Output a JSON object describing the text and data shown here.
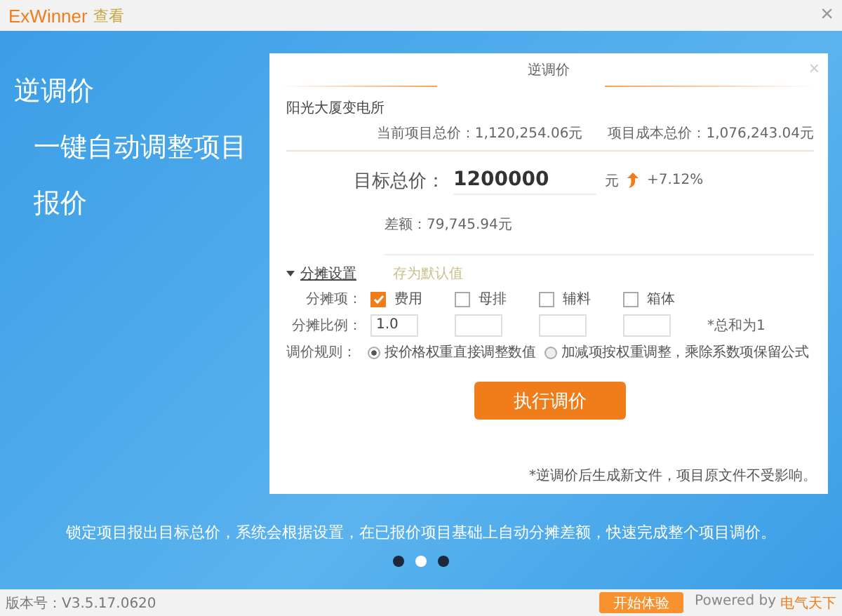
{
  "window": {
    "app_name": "ExWinner",
    "title": "查看",
    "close": "×"
  },
  "slide": {
    "heading": "逆调价",
    "subheading_lines": [
      "一键自动调整项目",
      "报价"
    ],
    "dialog": {
      "title": "逆调价",
      "close": "×",
      "project": "阳光大厦变电所",
      "current_total": "当前项目总价：1,120,254.06元",
      "cost_total": "项目成本总价：1,076,243.04元",
      "target_label": "目标总价：",
      "target_value": "1200000",
      "target_unit": "元",
      "change": "+7.12%",
      "difference": "差额：79,745.94元",
      "settings_toggle": "分摊设置",
      "settings_expanded": true,
      "save_default": "存为默认值",
      "items_label": "分摊项：",
      "items": [
        {
          "label": "费用",
          "checked": true,
          "ratio": "1.0"
        },
        {
          "label": "母排",
          "checked": false
        },
        {
          "label": "辅料",
          "checked": false
        },
        {
          "label": "箱体",
          "checked": false
        }
      ],
      "ratio_label": "分摊比例：",
      "ratio_note": "*总和为1",
      "rule_label": "调价规则：",
      "rules": [
        {
          "label": "按价格权重直接调整数值",
          "selected": true
        },
        {
          "label": "加减项按权重调整，乘除系数项保留公式",
          "selected": false
        }
      ],
      "run_button": "执行调价",
      "footnote": "*逆调价后生成新文件，项目原文件不受影响。"
    },
    "caption": "锁定项目报出目标总价，系统会根据设置，在已报价项目基础上自动分摊差额，快速完成整个项目调价。",
    "dots": [
      {
        "selected": false
      },
      {
        "selected": true
      },
      {
        "selected": false
      }
    ]
  },
  "footer": {
    "version": "版本号：V3.5.17.0620",
    "start_button": "开始体验",
    "powered_by": "Powered by",
    "brand": "电气天下"
  }
}
